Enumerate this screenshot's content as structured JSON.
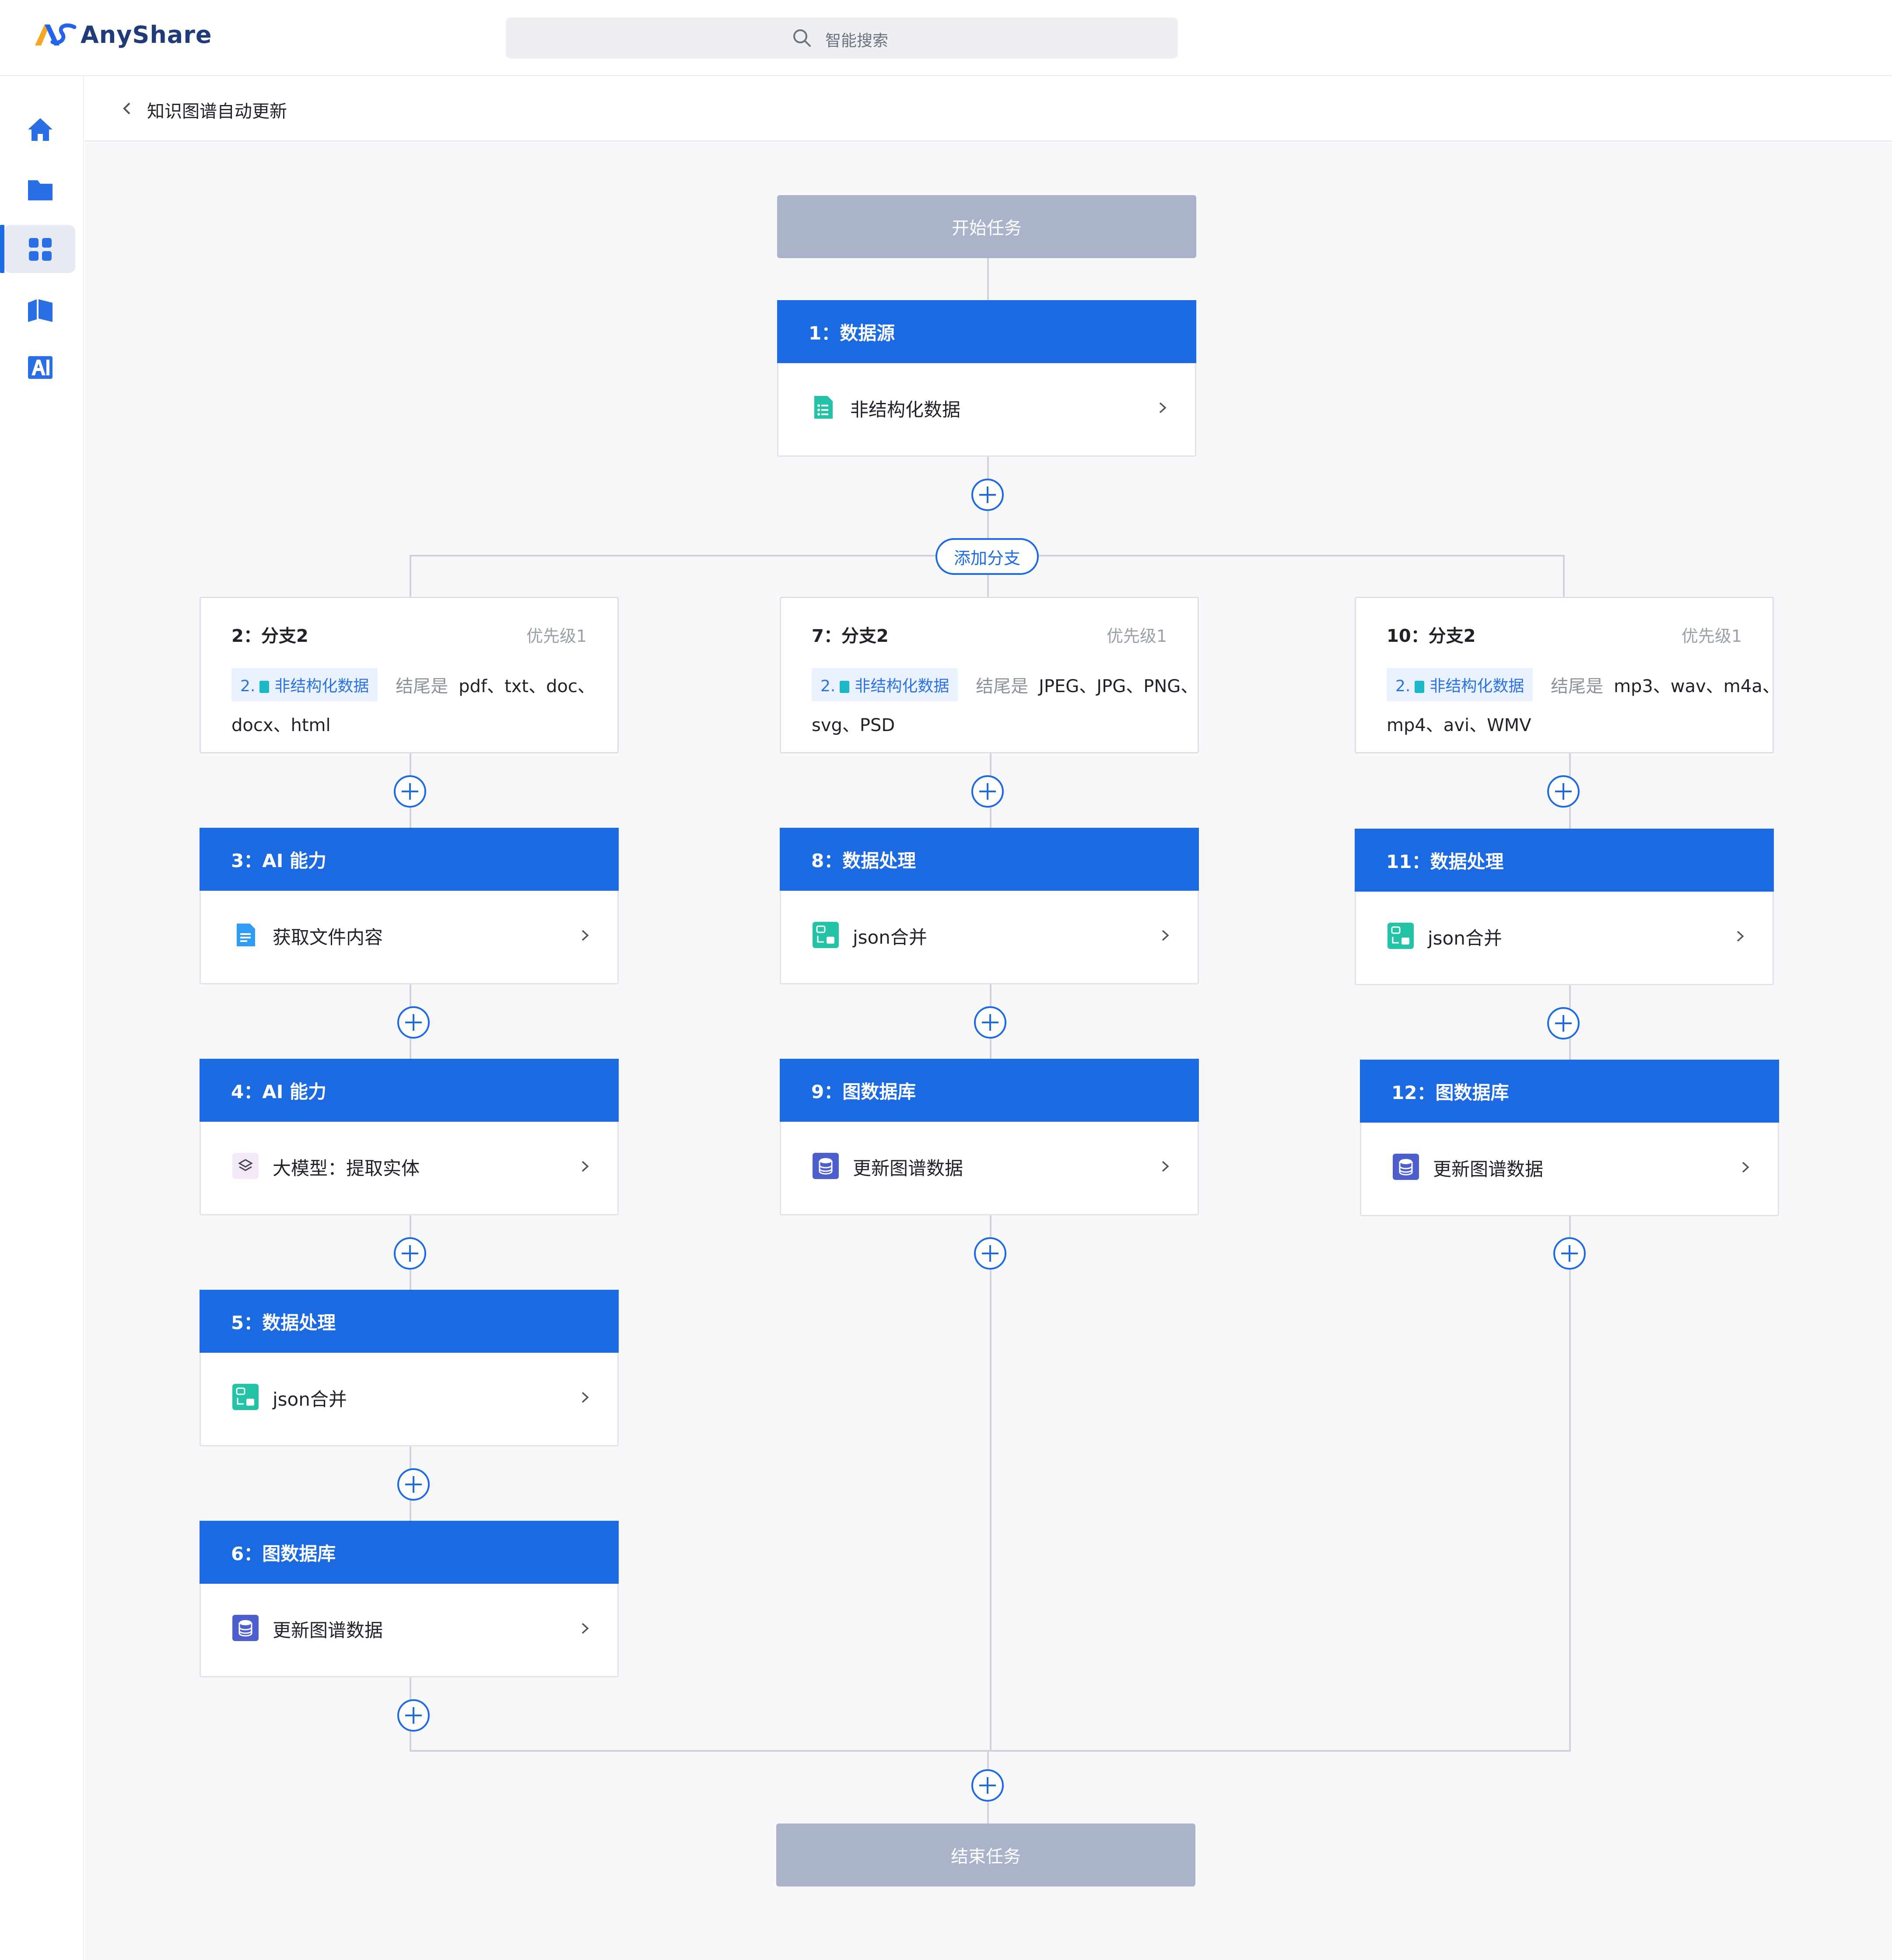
{
  "app": {
    "name": "AnyShare"
  },
  "search": {
    "placeholder": "智能搜索"
  },
  "sidebar": {
    "items": [
      {
        "icon": "home-icon"
      },
      {
        "icon": "folder-icon"
      },
      {
        "icon": "apps-grid-icon",
        "active": true
      },
      {
        "icon": "knowledge-book-icon"
      },
      {
        "icon": "ai-icon"
      }
    ]
  },
  "page": {
    "title": "知识图谱自动更新"
  },
  "colors": {
    "accent": "#1b6ae2",
    "terminal": "#abb3ca",
    "connector": "#cfd3da"
  },
  "flow": {
    "start": "开始任务",
    "end": "结束任务",
    "add_branch": "添加分支",
    "node1": {
      "title": "1：数据源",
      "label": "非结构化数据"
    },
    "branches": [
      {
        "title": "2：分支2",
        "priority": "优先级1",
        "tag_num": "2.",
        "tag_label": "非结构化数据",
        "cond": "结尾是",
        "value1": "pdf、txt、doc、",
        "value2": "docx、html"
      },
      {
        "title": "7：分支2",
        "priority": "优先级1",
        "tag_num": "2.",
        "tag_label": "非结构化数据",
        "cond": "结尾是",
        "value1": "JPEG、JPG、PNG、",
        "value2": "svg、PSD"
      },
      {
        "title": "10：分支2",
        "priority": "优先级1",
        "tag_num": "2.",
        "tag_label": "非结构化数据",
        "cond": "结尾是",
        "value1": "mp3、wav、m4a、",
        "value2": "mp4、avi、WMV"
      }
    ],
    "col1": [
      {
        "title": "3：AI 能力",
        "label": "获取文件内容",
        "icon": "file-text-icon"
      },
      {
        "title": "4：AI 能力",
        "label": "大模型：提取实体",
        "icon": "layers-icon"
      },
      {
        "title": "5：数据处理",
        "label": "json合并",
        "icon": "json-merge-icon"
      },
      {
        "title": "6：图数据库",
        "label": "更新图谱数据",
        "icon": "database-icon"
      }
    ],
    "col2": [
      {
        "title": "8：数据处理",
        "label": "json合并",
        "icon": "json-merge-icon"
      },
      {
        "title": "9：图数据库",
        "label": "更新图谱数据",
        "icon": "database-icon"
      }
    ],
    "col3": [
      {
        "title": "11：数据处理",
        "label": "json合并",
        "icon": "json-merge-icon"
      },
      {
        "title": "12：图数据库",
        "label": "更新图谱数据",
        "icon": "database-icon"
      }
    ]
  }
}
